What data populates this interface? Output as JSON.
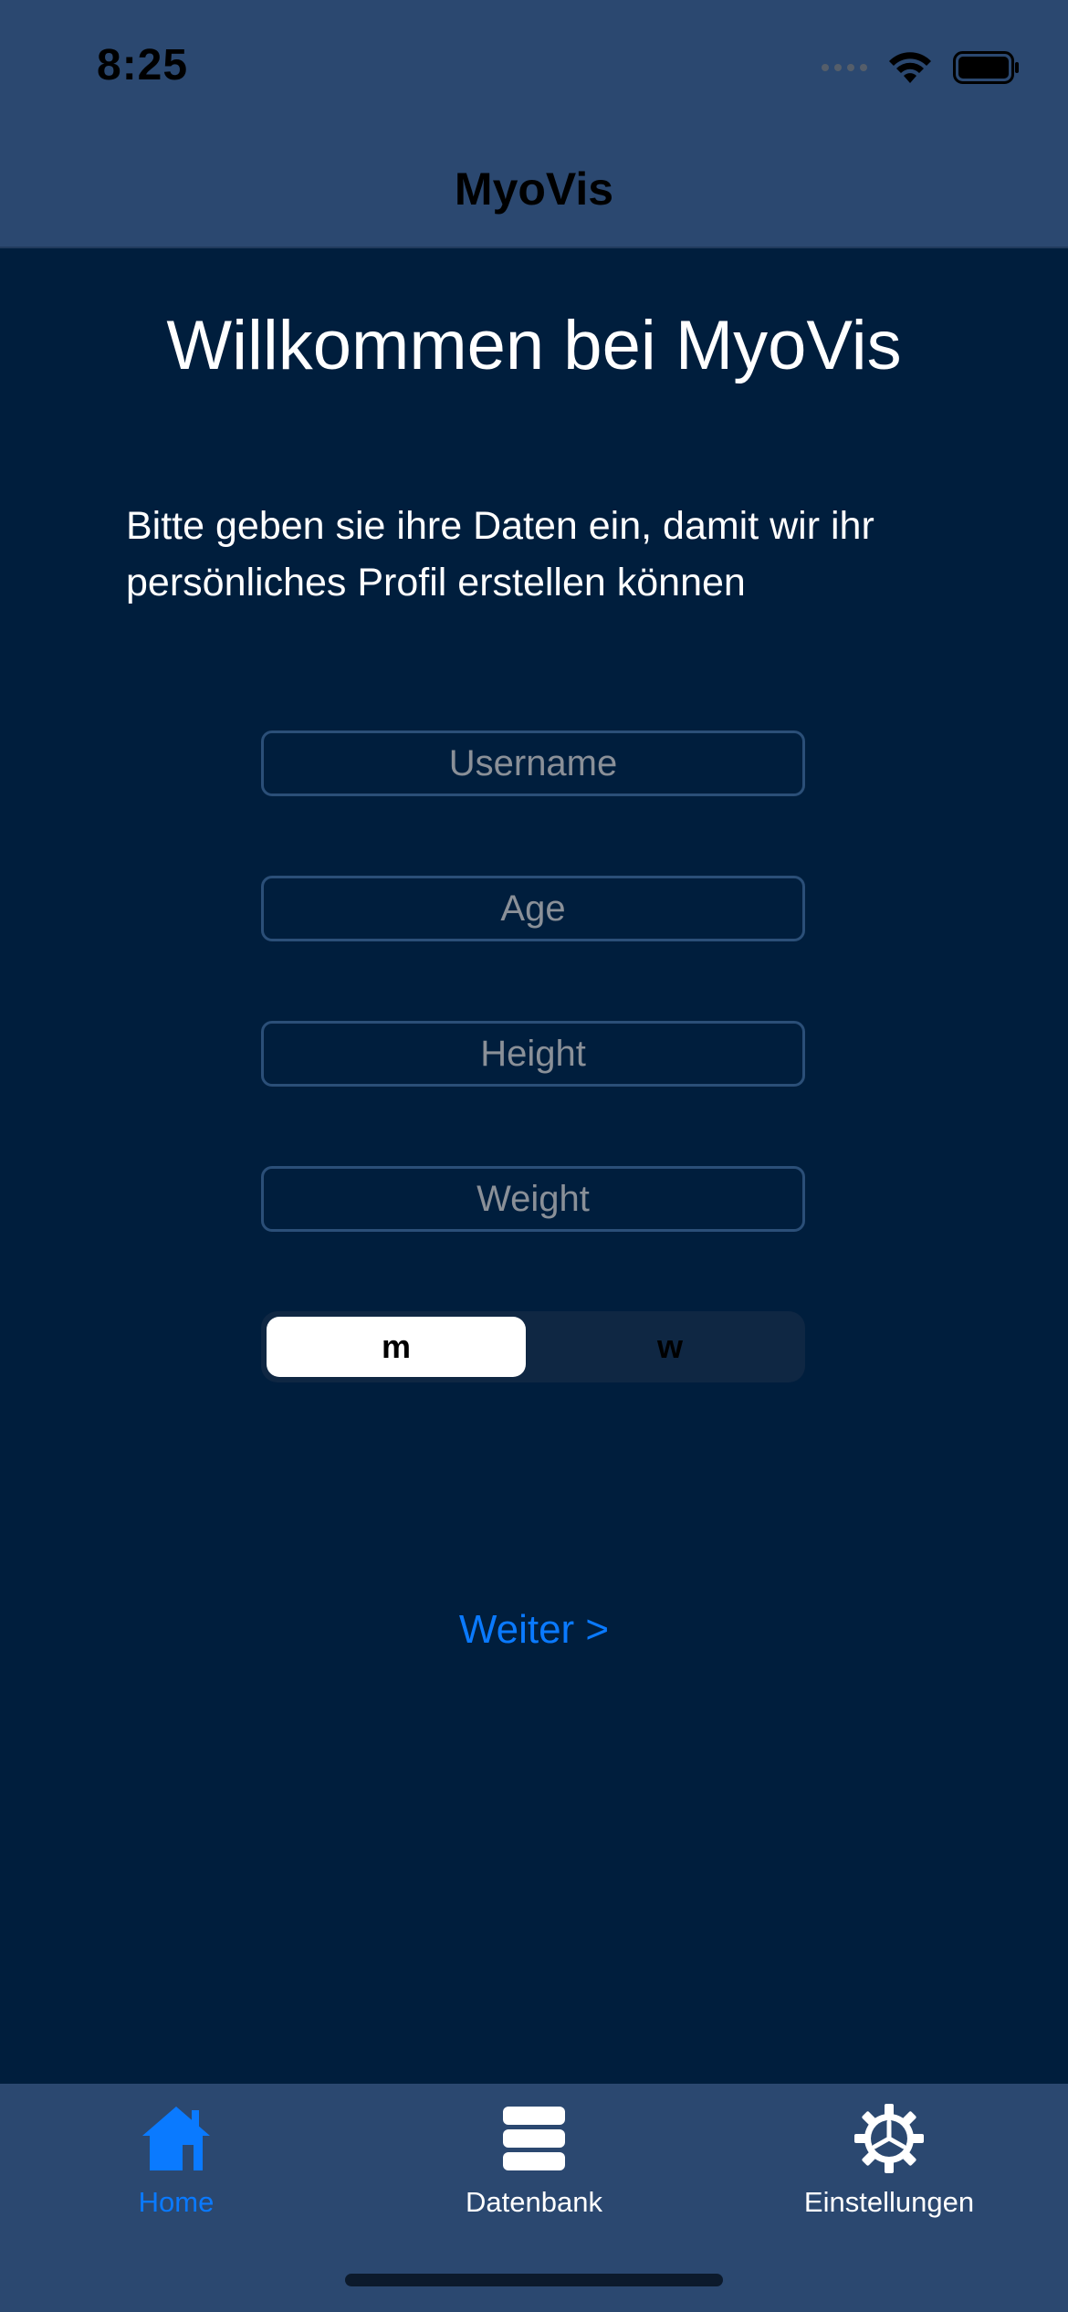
{
  "status_bar": {
    "time": "8:25"
  },
  "nav": {
    "title": "MyoVis"
  },
  "main": {
    "welcome": "Willkommen bei MyoVis",
    "intro": "Bitte geben sie ihre Daten ein, damit wir ihr persönliches Profil erstellen können",
    "fields": {
      "username": {
        "placeholder": "Username",
        "value": ""
      },
      "age": {
        "placeholder": "Age",
        "value": ""
      },
      "height": {
        "placeholder": "Height",
        "value": ""
      },
      "weight": {
        "placeholder": "Weight",
        "value": ""
      }
    },
    "gender": {
      "options": [
        "m",
        "w"
      ],
      "selected": "m"
    },
    "next_label": "Weiter >"
  },
  "tabbar": {
    "items": [
      {
        "label": "Home",
        "icon": "home-icon",
        "active": true
      },
      {
        "label": "Datenbank",
        "icon": "database-icon",
        "active": false
      },
      {
        "label": "Einstellungen",
        "icon": "gear-icon",
        "active": false
      }
    ]
  },
  "colors": {
    "background": "#001e3d",
    "bar": "#2b4870",
    "accent": "#0a7aff"
  }
}
